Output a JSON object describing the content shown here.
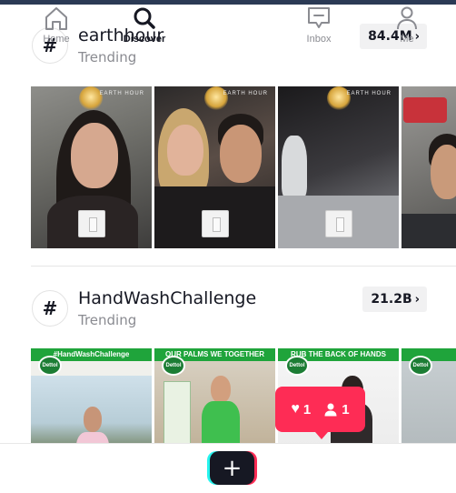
{
  "hashtags": [
    {
      "name": "earthhour",
      "subtitle": "Trending",
      "count": "84.4M",
      "thumb_watermark": "EARTH HOUR"
    },
    {
      "name": "HandWashChallenge",
      "subtitle": "Trending",
      "count": "21.2B",
      "thumb_banners": [
        "#HandWashChallenge",
        "OUR PALMS WE TOGETHER",
        "RUB THE BACK OF HANDS",
        ""
      ],
      "brand_logo": "Dettol"
    }
  ],
  "notification": {
    "likes": "1",
    "followers": "1"
  },
  "nav": {
    "home": "Home",
    "discover": "Discover",
    "inbox": "Inbox",
    "me": "Me",
    "active": "discover"
  },
  "colors": {
    "accent_red": "#fe2c55",
    "accent_cyan": "#25f4ee",
    "dettol_green": "#1fa43b",
    "text_primary": "#161823",
    "text_secondary": "#8a8b91"
  },
  "icons": [
    "hashtag-icon",
    "chevron-right-icon",
    "heart-icon",
    "person-icon",
    "home-icon",
    "search-icon",
    "plus-icon",
    "inbox-icon",
    "profile-icon"
  ]
}
